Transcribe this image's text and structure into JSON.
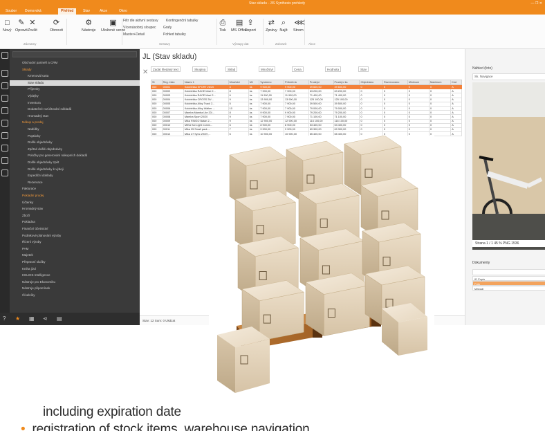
{
  "window": {
    "title": "Stav skladu - JIS Synthesis prehledy"
  },
  "menu": {
    "tabs": [
      "Soubor",
      "Domovská",
      "Přehled",
      "Stav",
      "Akce",
      "Okno"
    ],
    "active_index": 2
  },
  "ribbon": {
    "buttons": [
      {
        "label": "Nový"
      },
      {
        "label": "Opravit"
      },
      {
        "label": "Zrušit"
      },
      {
        "label": "Obnovit"
      },
      {
        "label": "Nástroje"
      },
      {
        "label": "Uložené verze"
      },
      {
        "label": "Tisk"
      },
      {
        "label": "MS Office"
      },
      {
        "label": "Export"
      },
      {
        "label": "Zprávy"
      },
      {
        "label": "Najít"
      },
      {
        "label": "Strom"
      }
    ],
    "small": [
      "Filtr dle aktivní sestavy",
      "Vícenásobný sloupec",
      "Master+Detail",
      "Grafy",
      "Pohled tabulky",
      "Kontingenční tabulky"
    ],
    "groups": [
      "Záznamy",
      "Sestavy",
      "Výstupy dat",
      "Zobrazit",
      "Akce"
    ]
  },
  "sidebar": {
    "items": [
      {
        "label": "Obchodní partneři a CRM",
        "type": "normal"
      },
      {
        "label": "Sklady",
        "type": "hdr"
      },
      {
        "label": "Kmenová karta",
        "type": "normal"
      },
      {
        "label": "Stav skladu",
        "type": "sel"
      },
      {
        "label": "Příjemky",
        "type": "normal"
      },
      {
        "label": "Výdejky",
        "type": "normal"
      },
      {
        "label": "Inventura",
        "type": "normal"
      },
      {
        "label": "Dodatečné rozúčtování nákladů",
        "type": "normal"
      },
      {
        "label": "Hromadný stav",
        "type": "normal"
      },
      {
        "label": "Nákup a prodej",
        "type": "hdr"
      },
      {
        "label": "Nabídky",
        "type": "normal"
      },
      {
        "label": "Poptávky",
        "type": "normal"
      },
      {
        "label": "Došlé objednávky",
        "type": "normal"
      },
      {
        "label": "Zpětné došlé objednávky",
        "type": "normal"
      },
      {
        "label": "Položky pro generování nákupních dokladů",
        "type": "normal"
      },
      {
        "label": "Došlé objednávky zpět",
        "type": "normal"
      },
      {
        "label": "Došlé objednávky k výdeji",
        "type": "normal"
      },
      {
        "label": "Expediční doklady",
        "type": "normal"
      },
      {
        "label": "Rezervace",
        "type": "normal"
      },
      {
        "label": "Fakturace",
        "type": "normal"
      },
      {
        "label": "Pokladní prodej",
        "type": "hdr"
      },
      {
        "label": "Účtenky",
        "type": "normal"
      },
      {
        "label": "Hromadný stav",
        "type": "normal"
      },
      {
        "label": "Zboží",
        "type": "normal"
      },
      {
        "label": "Pokladna",
        "type": "normal"
      },
      {
        "label": "Finanční účetnictví",
        "type": "normal"
      },
      {
        "label": "Podnikové plánování výroby",
        "type": "normal"
      },
      {
        "label": "Řízení výroby",
        "type": "normal"
      },
      {
        "label": "PAM",
        "type": "normal"
      },
      {
        "label": "Majetek",
        "type": "normal"
      },
      {
        "label": "Přepravní služby",
        "type": "normal"
      },
      {
        "label": "Kniha jízd",
        "type": "normal"
      },
      {
        "label": "HELIOS Intelligence",
        "type": "normal"
      },
      {
        "label": "Nástroje pro Ekonomiku",
        "type": "normal"
      },
      {
        "label": "Nástroje připomínek",
        "type": "normal"
      },
      {
        "label": "Číselníky",
        "type": "normal"
      }
    ]
  },
  "main": {
    "title": "JL (Stav skladu)",
    "toolbar": [
      "Zadat hledaný text",
      "Skupina",
      "Sklad",
      "Množství",
      "Cena",
      "Hodnota",
      "Stav"
    ],
    "columns": [
      "St",
      "Reg. číslo",
      "Název 1",
      "Množství",
      "MJ",
      "Vyrobeno",
      "Průměrná",
      "Prodejní",
      "Prodejní ks",
      "Objednáno",
      "Rezervováno",
      "Minimum",
      "Maximum",
      "Kód"
    ],
    "rows": [
      [
        "000",
        "00001",
        "Koloběžka SPORT 26/20",
        "4",
        "ks",
        "9 900,00",
        "9 900,00",
        "39 600,00",
        "39 600,00",
        "0",
        "0",
        "0",
        "0",
        "A"
      ],
      [
        "000",
        "00002",
        "Koloběžka RACE Maxi 2...",
        "8",
        "ks",
        "7 900,00",
        "7 900,00",
        "63 200,00",
        "63 200,00",
        "0",
        "0",
        "0",
        "0",
        "A"
      ],
      [
        "000",
        "00003",
        "Koloběžka RACE Maxi 2...",
        "6",
        "ks",
        "11 900,00",
        "11 900,00",
        "71 400,00",
        "71 400,00",
        "0",
        "0",
        "0",
        "0",
        "A"
      ],
      [
        "000",
        "00004",
        "Koloběžka CROSS 26/...",
        "9",
        "ks",
        "13 900,00",
        "13 900,00",
        "125 100,00",
        "125 100,00",
        "0",
        "0",
        "0",
        "0",
        "A"
      ],
      [
        "000",
        "00005",
        "Koloběžka Alloy Track 2...",
        "5",
        "ks",
        "7 900,00",
        "7 900,00",
        "39 500,00",
        "39 500,00",
        "0",
        "0",
        "0",
        "0",
        "A"
      ],
      [
        "000",
        "00006",
        "Koloběžka Alloy Walker ...",
        "10",
        "ks",
        "7 900,00",
        "7 900,00",
        "79 000,00",
        "79 000,00",
        "0",
        "0",
        "0",
        "0",
        "A"
      ],
      [
        "000",
        "00007",
        "Mamba Mamba Lite 20/...",
        "8",
        "ks",
        "9 900,00",
        "9 900,00",
        "79 200,00",
        "79 200,00",
        "0",
        "0",
        "0",
        "0",
        "A"
      ],
      [
        "000",
        "00008",
        "Mamba Sport 20/20",
        "9",
        "ks",
        "7 900,00",
        "7 900,00",
        "71 100,00",
        "71 100,00",
        "0",
        "0",
        "0",
        "0",
        "A"
      ],
      [
        "000",
        "00009",
        "Mika RINGO Batan 2...",
        "9",
        "ks",
        "12 900,00",
        "12 900,00",
        "116 100,00",
        "116 100,00",
        "0",
        "0",
        "0",
        "0",
        "A"
      ],
      [
        "000",
        "00010",
        "MIKA Sol Light Comm...",
        "6",
        "ks",
        "8 900,00",
        "8 900,00",
        "53 400,00",
        "53 400,00",
        "0",
        "0",
        "0",
        "0",
        "A"
      ],
      [
        "000",
        "00011",
        "Mika 25 Small pack ...",
        "7",
        "ks",
        "9 900,00",
        "9 900,00",
        "69 300,00",
        "69 300,00",
        "0",
        "0",
        "0",
        "0",
        "A"
      ],
      [
        "000",
        "00012",
        "Mika 27 Sync 29/29 ...",
        "6",
        "ks",
        "10 900,00",
        "10 900,00",
        "65 400,00",
        "65 400,00",
        "0",
        "0",
        "0",
        "0",
        "A"
      ]
    ],
    "selected_row": 0,
    "statusbar": "Stav: 12   Sum: 0   Ukázat"
  },
  "right": {
    "title": "Náhled (foto)",
    "toolbar": "Sk. Navigace",
    "photo_info": "Strana 1 / 1   45 %   PNG   1536",
    "docs_title": "Dokumenty",
    "docs_rows": [
      "ID  Popis",
      "Foto",
      "Manuál"
    ],
    "docs_selected": 1
  },
  "caption": {
    "line1": "including expiration date",
    "line2": "registration of stock items, warehouse navigation"
  },
  "colors": {
    "accent": "#f08a1c",
    "selected_row": "#f3813a",
    "sidebar_bg": "#3a3a3a"
  }
}
